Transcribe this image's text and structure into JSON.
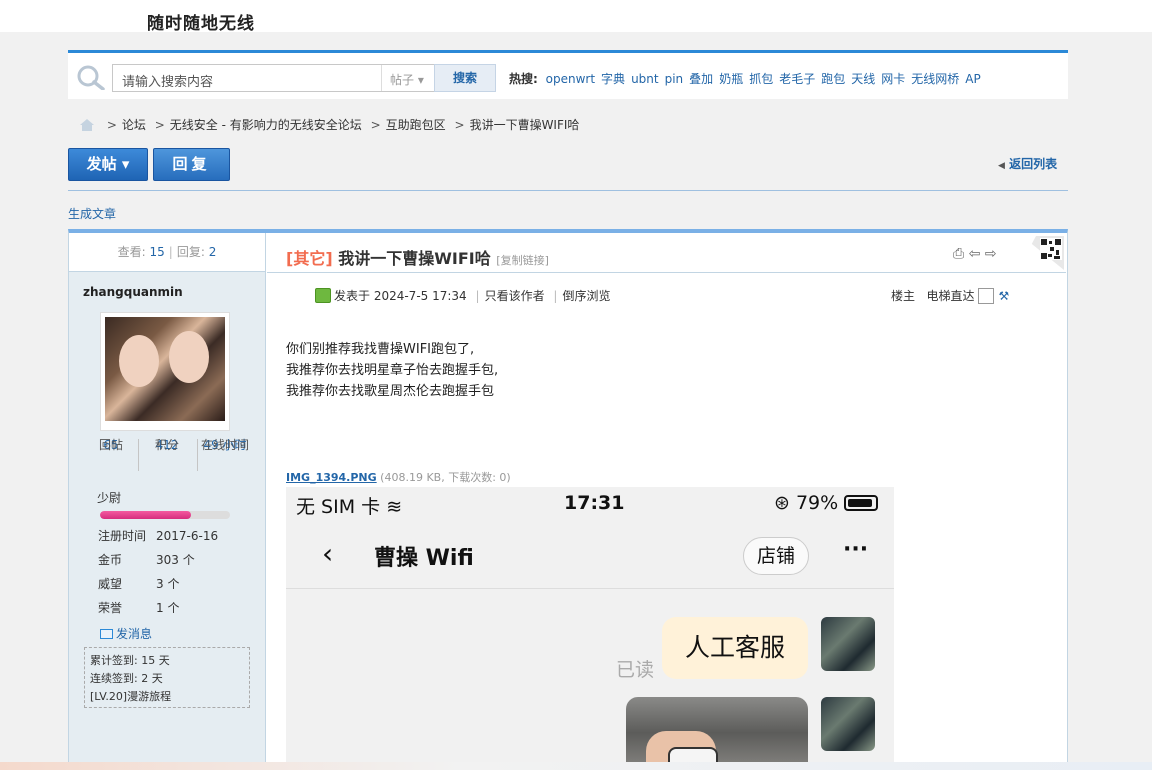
{
  "site": {
    "name": "随时随地无线"
  },
  "search": {
    "placeholder": "请输入搜索内容",
    "type_label": "帖子",
    "button_label": "搜索",
    "hot_label": "热搜:",
    "hot_terms": [
      "openwrt",
      "字典",
      "ubnt",
      "pin",
      "叠加",
      "奶瓶",
      "抓包",
      "老毛子",
      "跑包",
      "天线",
      "网卡",
      "无线网桥",
      "AP"
    ]
  },
  "breadcrumb": [
    "论坛",
    "无线安全 - 有影响力的无线安全论坛",
    "互助跑包区",
    "我讲一下曹操WIFI哈"
  ],
  "toolbar": {
    "post_label": "发帖",
    "reply_label": "回复",
    "back_label": "返回列表"
  },
  "generate_label": "生成文章",
  "thread": {
    "views_label": "查看:",
    "views": "15",
    "replies_label": "回复:",
    "replies": "2",
    "category": "[其它]",
    "title": "我讲一下曹操WIFI哈",
    "copy_link": "[复制链接]"
  },
  "user": {
    "name": "zhangquanmin",
    "stats": [
      {
        "value": "65",
        "label": "回帖"
      },
      {
        "value": "412",
        "label": "积分"
      },
      {
        "value": "49 小时",
        "label": "在线时间"
      }
    ],
    "rank": "少尉",
    "rank_progress": 0.7,
    "info": [
      {
        "k": "注册时间",
        "v": "2017-6-16"
      },
      {
        "k": "金币",
        "v": "303 个"
      },
      {
        "k": "威望",
        "v": "3 个"
      },
      {
        "k": "荣誉",
        "v": "1 个"
      }
    ],
    "message_label": "发消息",
    "sign": [
      "累计签到: 15 天",
      "连续签到: 2 天",
      "[LV.20]漫游旅程"
    ]
  },
  "post": {
    "posted": "发表于 2024-7-5 17:34",
    "only_author": "只看该作者",
    "reverse": "倒序浏览",
    "floor": "楼主",
    "elevator": "电梯直达",
    "lines": [
      "你们别推荐我找曹操WIFI跑包了,",
      "我推荐你去找明星章子怡去跑握手包,",
      "我推荐你去找歌星周杰伦去跑握手包"
    ],
    "attach_name": "IMG_1394.PNG",
    "attach_meta": "(408.19 KB, 下载次数: 0)"
  },
  "screenshot": {
    "carrier": "无 SIM 卡",
    "time": "17:31",
    "battery": "79%",
    "chat_title": "曹操 Wifi",
    "shop": "店铺",
    "more": "···",
    "bubble": "人工客服",
    "read": "已读"
  }
}
